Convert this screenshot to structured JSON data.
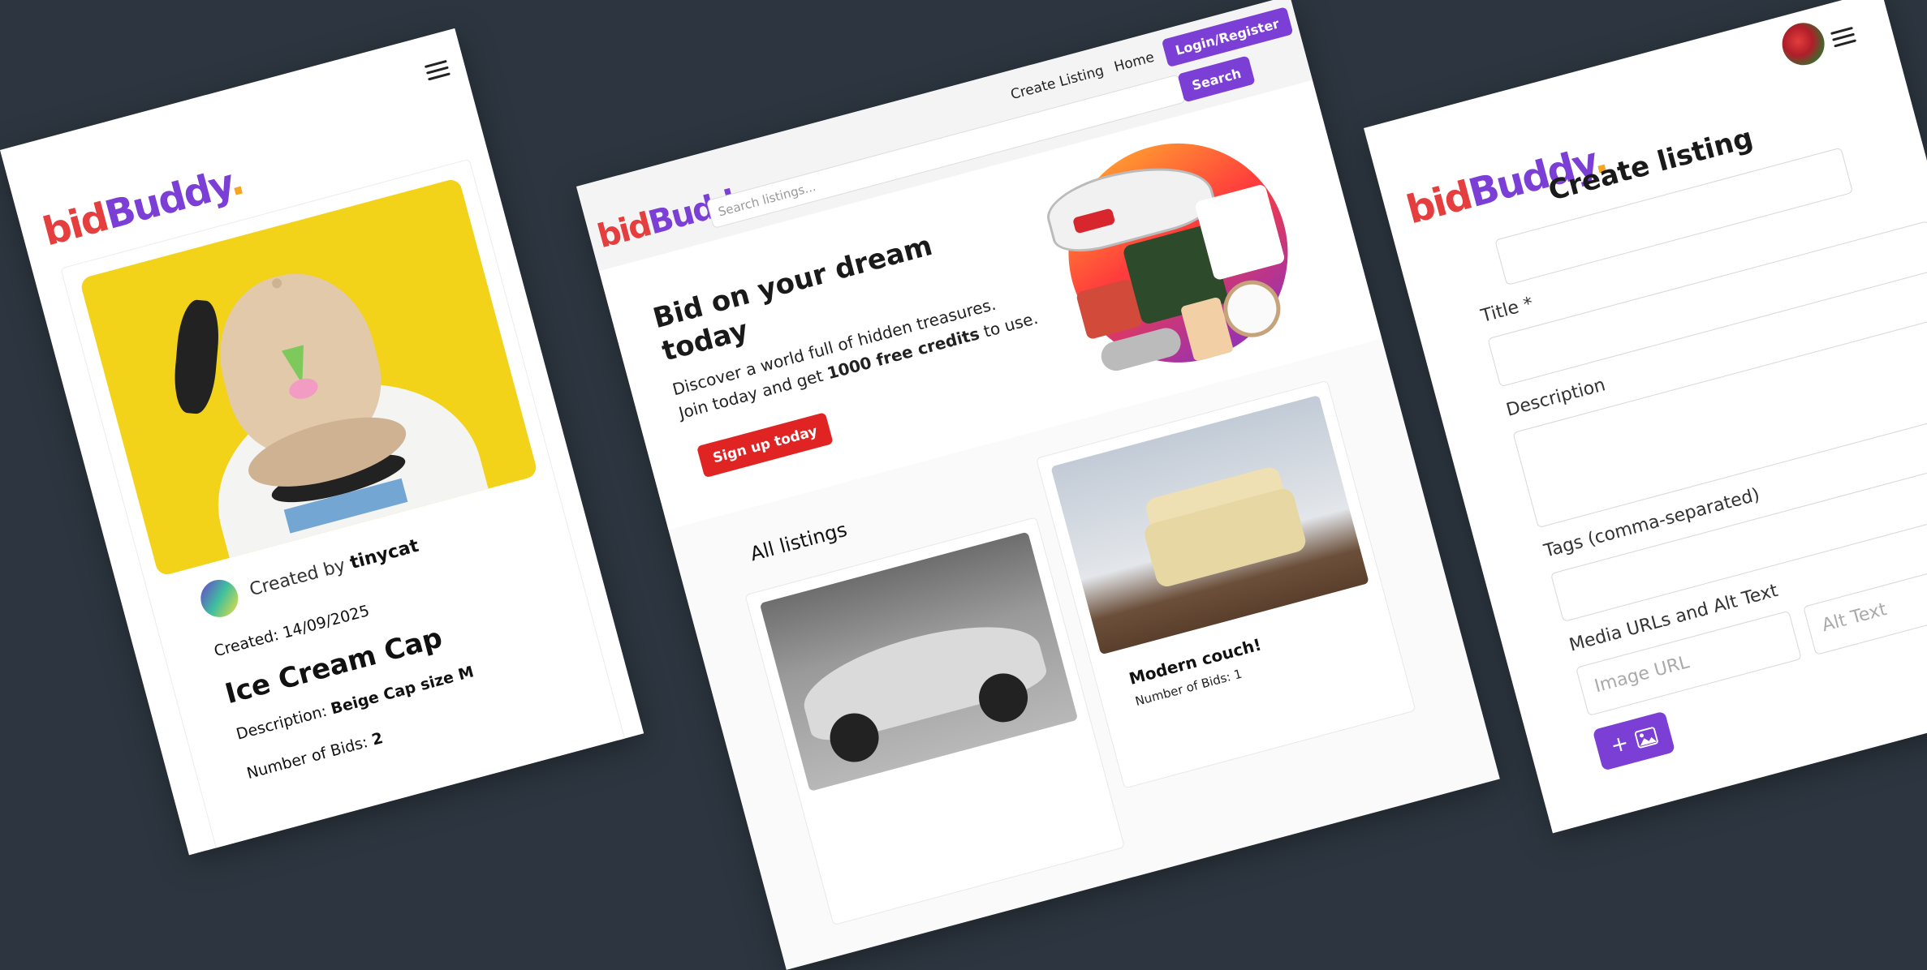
{
  "brand": {
    "bid": "bid",
    "buddy": "Buddy",
    "dot": "."
  },
  "colors": {
    "accent": "#7b3fd6",
    "brand_red": "#e53e3e",
    "cta_red": "#e02424",
    "background": "#2d3640"
  },
  "item_page": {
    "created_by_label": "Created by",
    "creator": "tinycat",
    "created_label": "Created:",
    "created_date": "14/09/2025",
    "title": "Ice Cream Cap",
    "description_label": "Description:",
    "description": "Beige Cap size M",
    "bids_label": "Number of Bids:",
    "bids": "2"
  },
  "home_page": {
    "nav": {
      "create_listing": "Create Listing",
      "home": "Home",
      "login": "Login/Register"
    },
    "search": {
      "placeholder": "Search listings...",
      "button": "Search"
    },
    "hero": {
      "heading": "Bid on your dream today",
      "text_1": "Discover a world full of hidden treasures.",
      "text_2": "Join today and get",
      "text_bold": "1000 free credits",
      "text_3": "to use.",
      "cta": "Sign up today"
    },
    "listings_title": "All listings",
    "listings": [
      {
        "title": "",
        "bids": ""
      },
      {
        "title": "Modern couch!",
        "bids": "Number of Bids: 1"
      }
    ]
  },
  "create_page": {
    "heading": "Create listing",
    "title_label": "Title *",
    "description_label": "Description",
    "tags_label": "Tags (comma-separated)",
    "media_label": "Media URLs and Alt Text",
    "image_url_placeholder": "Image URL",
    "alt_text_placeholder": "Alt Text",
    "add_media_button": "+"
  }
}
